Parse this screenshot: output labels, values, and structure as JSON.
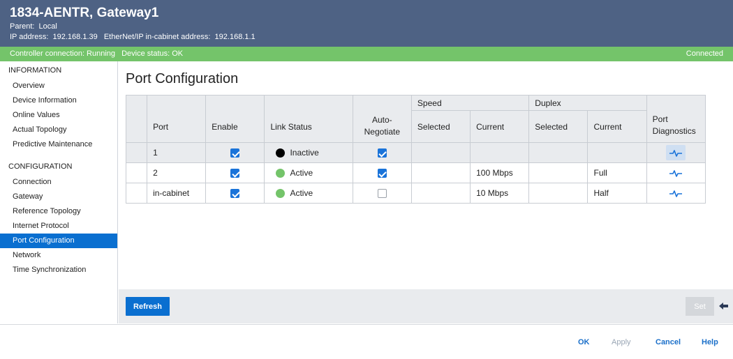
{
  "header": {
    "title": "1834-AENTR, Gateway1",
    "parent_label": "Parent:",
    "parent_value": "Local",
    "ip_label": "IP address:",
    "ip_value": "192.168.1.39",
    "incab_label": "EtherNet/IP in-cabinet address:",
    "incab_value": "192.168.1.1"
  },
  "status": {
    "controller_connection": "Controller connection: Running",
    "device_status": "Device status: OK",
    "connected": "Connected",
    "color": "#74c46a"
  },
  "sidebar": {
    "information_heading": "INFORMATION",
    "information_items": [
      "Overview",
      "Device Information",
      "Online Values",
      "Actual Topology",
      "Predictive Maintenance"
    ],
    "configuration_heading": "CONFIGURATION",
    "configuration_items": [
      "Connection",
      "Gateway",
      "Reference Topology",
      "Internet Protocol",
      "Port Configuration",
      "Network",
      "Time Synchronization"
    ],
    "active_item": "Port Configuration"
  },
  "page": {
    "title": "Port Configuration"
  },
  "table": {
    "headers": {
      "port": "Port",
      "enable": "Enable",
      "link_status": "Link Status",
      "auto_negotiate": "Auto-\nNegotiate",
      "speed": "Speed",
      "speed_selected": "Selected",
      "speed_current": "Current",
      "duplex": "Duplex",
      "duplex_selected": "Selected",
      "duplex_current": "Current",
      "diagnostics": "Port\nDiagnostics"
    },
    "rows": [
      {
        "port": "1",
        "enable": true,
        "link_status": "Inactive",
        "link_color": "#000000",
        "auto_negotiate": true,
        "speed_selected": "",
        "speed_current": "",
        "duplex_selected": "",
        "duplex_current": ""
      },
      {
        "port": "2",
        "enable": true,
        "link_status": "Active",
        "link_color": "#74c46a",
        "auto_negotiate": true,
        "speed_selected": "",
        "speed_current": "100 Mbps",
        "duplex_selected": "",
        "duplex_current": "Full"
      },
      {
        "port": "in-cabinet",
        "enable": true,
        "link_status": "Active",
        "link_color": "#74c46a",
        "auto_negotiate": false,
        "speed_selected": "",
        "speed_current": "10 Mbps",
        "duplex_selected": "",
        "duplex_current": "Half"
      }
    ],
    "diagnostics_icon": "pulse-icon"
  },
  "actions": {
    "refresh_label": "Refresh",
    "set_label": "Set"
  },
  "footer": {
    "ok": "OK",
    "apply": "Apply",
    "cancel": "Cancel",
    "help": "Help"
  },
  "colors": {
    "header_bg": "#4e6284",
    "accent": "#0a6fd0"
  }
}
